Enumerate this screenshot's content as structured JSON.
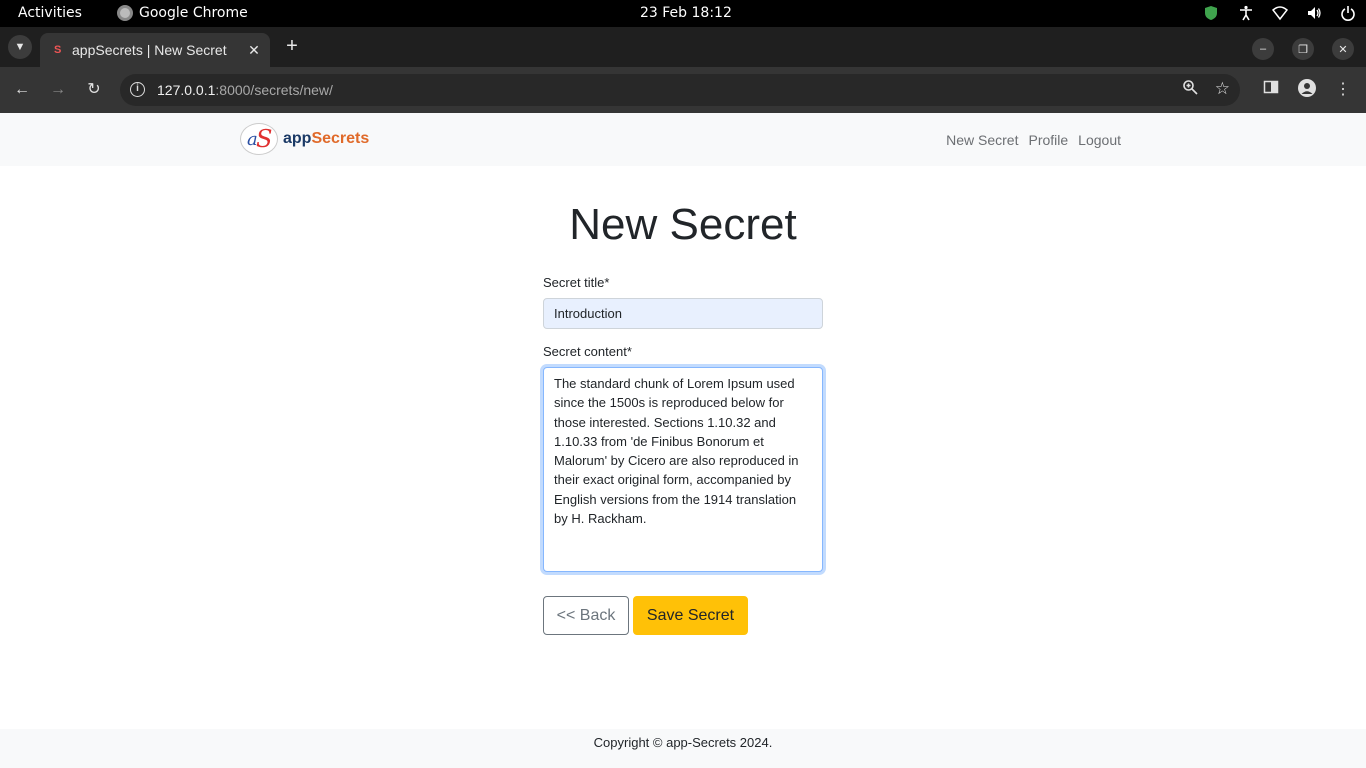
{
  "os_bar": {
    "activities": "Activities",
    "app_name": "Google Chrome",
    "clock": "23 Feb  18:12"
  },
  "browser": {
    "tab_title": "appSecrets | New Secret",
    "tab_favicon": "S",
    "url_host": "127.0.0.1",
    "url_rest": ":8000/secrets/new/"
  },
  "navbar": {
    "brand_part1": "app",
    "brand_part2": "Secrets",
    "links": [
      "New Secret",
      "Profile",
      "Logout"
    ]
  },
  "page": {
    "heading": "New Secret",
    "title_label": "Secret title*",
    "title_value": "Introduction",
    "content_label": "Secret content*",
    "content_value": "The standard chunk of Lorem Ipsum used since the 1500s is reproduced below for those interested. Sections 1.10.32 and 1.10.33 from 'de Finibus Bonorum et Malorum' by Cicero are also reproduced in their exact original form, accompanied by English versions from the 1914 translation by H. Rackham.",
    "back_button": "<< Back",
    "save_button": "Save Secret"
  },
  "footer": {
    "text": "Copyright © app-Secrets 2024."
  },
  "colors": {
    "save_button": "#ffc107",
    "brand_dark": "#1b3a66",
    "brand_orange": "#e06a2a"
  }
}
